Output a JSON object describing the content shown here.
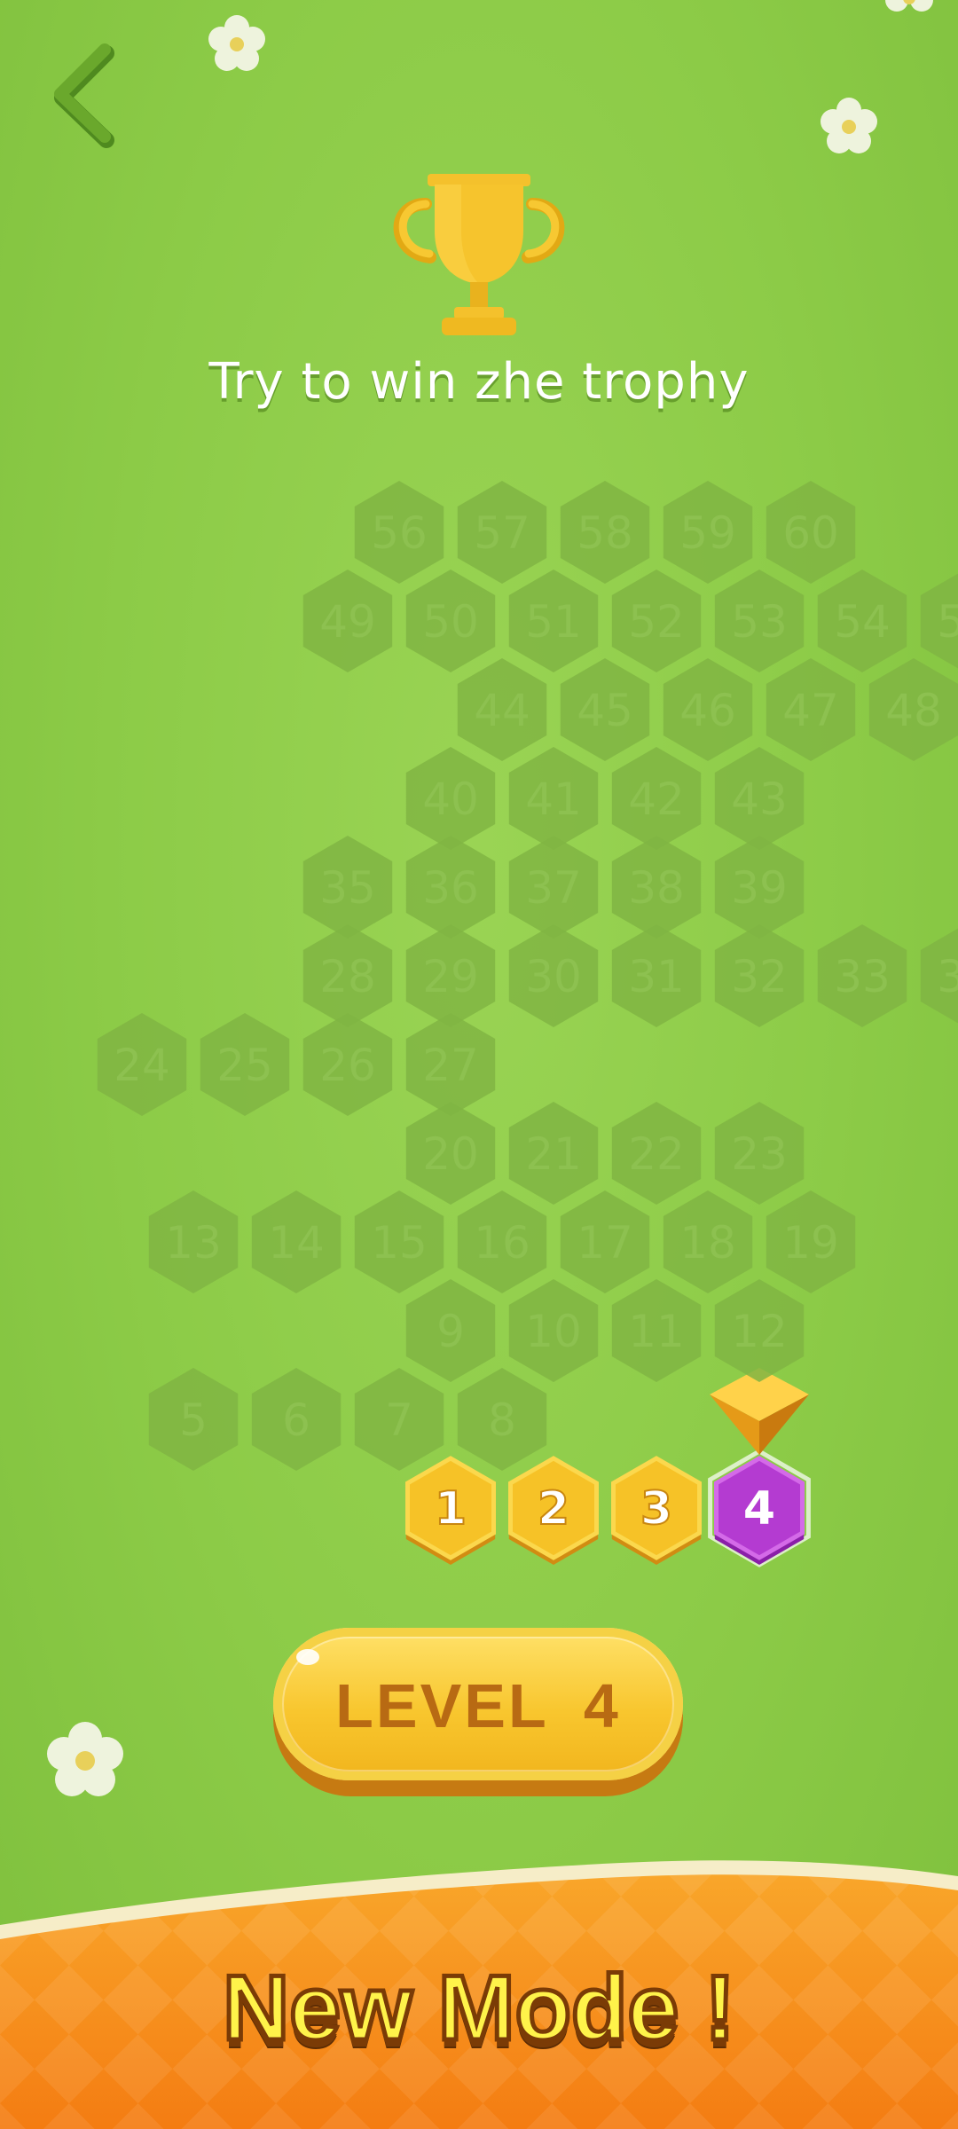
{
  "header": {
    "back_icon": "chevron-left-icon",
    "trophy_icon": "trophy-icon",
    "subtitle": "Try to win zhe trophy"
  },
  "board": {
    "completed_levels": [
      1,
      2,
      3
    ],
    "current_level": 4,
    "locked_levels_range": [
      5,
      60
    ],
    "current_marker_icon": "diamond-pointer-icon",
    "colors": {
      "completed": "#f6c227",
      "current": "#b43bd1",
      "locked": "#80b543"
    }
  },
  "level_button": {
    "label": "LEVEL  4"
  },
  "banner": {
    "text": "New Mode !"
  },
  "theme": {
    "background": "#8ccb47",
    "banner": "#f7931e"
  }
}
